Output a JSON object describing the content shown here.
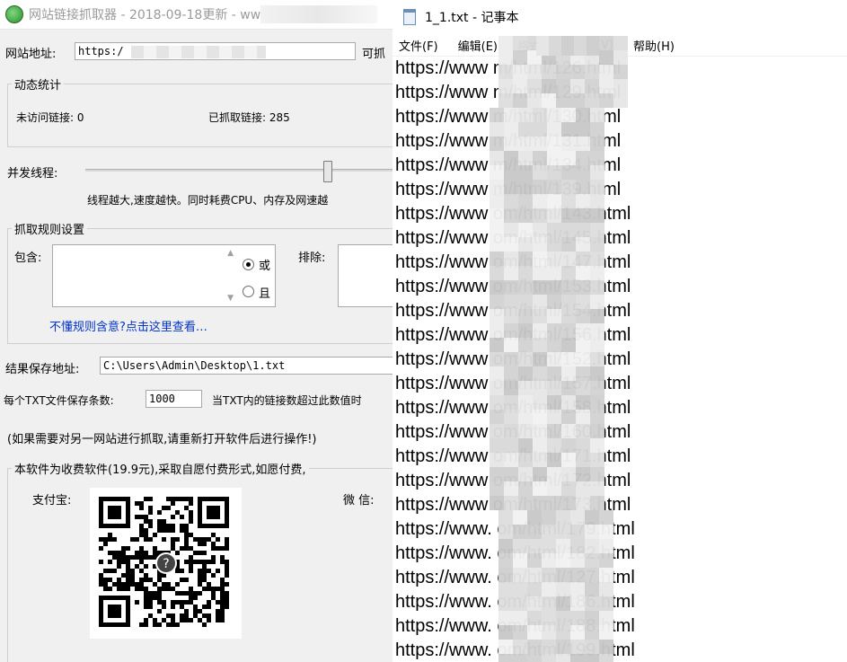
{
  "crawler": {
    "title": "网站链接抓取器 - 2018-09-18更新 - ww",
    "site_label": "网站地址:",
    "site_value": "https:/",
    "fetch_button": "可抓",
    "stats": {
      "title": "动态统计",
      "unvisited_label": "未访问链接: 0",
      "fetched_label": "已抓取链接: 285"
    },
    "threads_label": "并发线程:",
    "threads_level": 0.78,
    "threads_hint": "线程越大,速度越快。同时耗费CPU、内存及网速越",
    "rules": {
      "title": "抓取规则设置",
      "include_label": "包含:",
      "exclude_label": "排除:",
      "or_label": "或",
      "and_label": "且",
      "help_link": "不懂规则含意?点击这里查看…"
    },
    "save_label": "结果保存地址:",
    "save_value": "C:\\Users\\Admin\\Desktop\\1.txt",
    "per_file_label": "每个TXT文件保存条数:",
    "per_file_value": "1000",
    "per_file_hint": "当TXT内的链接数超过此数值时",
    "note": "(如果需要对另一网站进行抓取,请重新打开软件后进行操作!)",
    "pay": {
      "title": "本软件为收费软件(19.9元),采取自愿付费形式,如愿付费,",
      "alipay_label": "支付宝:",
      "wechat_label": "微 信:"
    }
  },
  "notepad": {
    "title": "1_1.txt - 记事本",
    "menu": [
      "文件(F)",
      "编辑(E)",
      "格式",
      "(V)",
      "帮助(H)"
    ],
    "lines": [
      "https://www                     m/html/126.html",
      "https://www                     m/html/129.html",
      "https://www                     m/html/130.html",
      "https://www                     m/html/131.html",
      "https://www                     m/html/134.html",
      "https://www                     m/html/139.html",
      "https://www                   om/html/143.html",
      "https://www                   om/html/145.html",
      "https://www                   om/html/147.html",
      "https://www                   om/html/153.html",
      "https://www                   om/html/154.html",
      "https://www                   om/html/156.html",
      "https://www                   om/html/152.html",
      "https://www                   om/html/157.html",
      "https://www                   om/html/158.html",
      "https://www                   om/html/160.html",
      "https://www                   om/html/171.html",
      "https://www                   om/html/172.html",
      "https://www                   om/html/173.html",
      "https://www.                  om/html/179.html",
      "https://www.                  om/html/182.html",
      "https://www.                  om/html/127.html",
      "https://www.                  om/html/186.html",
      "https://www.                  om/html/188.html",
      "https://www.                  om/html/199.html"
    ]
  },
  "colors": {
    "link": "#0033cc",
    "window_bg": "#f0f0f0"
  }
}
